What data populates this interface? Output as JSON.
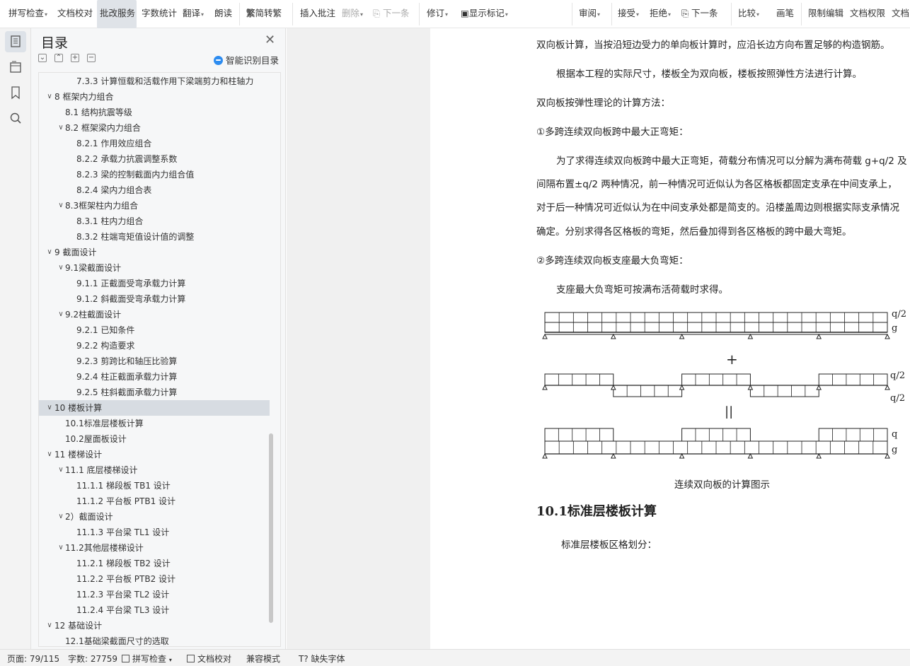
{
  "ribbon": {
    "spell_check": "拼写检查",
    "doc_proofread": "文档校对",
    "review_service": "批改服务",
    "word_count": "字数统计",
    "translate": "翻译",
    "read_aloud": "朗读",
    "simp_trad": "简转繁",
    "insert_comment": "插入批注",
    "delete": "删除",
    "next": "下一条",
    "track_changes": "修订",
    "show_markup": "显示标记",
    "review": "审阅",
    "accept": "接受",
    "reject": "拒绝",
    "next2": "下一条",
    "compare": "比较",
    "pen": "画笔",
    "restrict_edit": "限制编辑",
    "doc_permission": "文档权限",
    "more": "文档"
  },
  "toc": {
    "title": "目录",
    "smart_label": "智能识别目录",
    "items": [
      {
        "level": 3,
        "expand": "",
        "text": "7.3.3  计算恒载和活载作用下梁端剪力和柱轴力"
      },
      {
        "level": 1,
        "expand": "v",
        "text": "8  框架内力组合"
      },
      {
        "level": 2,
        "expand": "",
        "text": "8.1  结构抗震等级"
      },
      {
        "level": 2,
        "expand": "v",
        "text": "8.2  框架梁内力组合"
      },
      {
        "level": 3,
        "expand": "",
        "text": "8.2.1 作用效应组合"
      },
      {
        "level": 3,
        "expand": "",
        "text": "8.2.2 承载力抗震调整系数"
      },
      {
        "level": 3,
        "expand": "",
        "text": "8.2.3 梁的控制截面内力组合值"
      },
      {
        "level": 3,
        "expand": "",
        "text": "8.2.4 梁内力组合表"
      },
      {
        "level": 2,
        "expand": "v",
        "text": "8.3框架柱内力组合"
      },
      {
        "level": 3,
        "expand": "",
        "text": "8.3.1 柱内力组合"
      },
      {
        "level": 3,
        "expand": "",
        "text": "8.3.2  柱端弯矩值设计值的调整"
      },
      {
        "level": 1,
        "expand": "v",
        "text": "9  截面设计"
      },
      {
        "level": 2,
        "expand": "v",
        "text": "9.1梁截面设计"
      },
      {
        "level": 3,
        "expand": "",
        "text": "9.1.1 正截面受弯承载力计算"
      },
      {
        "level": 3,
        "expand": "",
        "text": "9.1.2 斜截面受弯承载力计算"
      },
      {
        "level": 2,
        "expand": "v",
        "text": "9.2柱截面设计"
      },
      {
        "level": 3,
        "expand": "",
        "text": "9.2.1 已知条件"
      },
      {
        "level": 3,
        "expand": "",
        "text": "9.2.2 构造要求"
      },
      {
        "level": 3,
        "expand": "",
        "text": "9.2.3 剪跨比和轴压比验算"
      },
      {
        "level": 3,
        "expand": "",
        "text": "9.2.4 柱正截面承载力计算"
      },
      {
        "level": 3,
        "expand": "",
        "text": "9.2.5 柱斜截面承载力计算"
      },
      {
        "level": 1,
        "expand": "v",
        "text": "10 楼板计算",
        "selected": true
      },
      {
        "level": 2,
        "expand": "",
        "text": "10.1标准层楼板计算"
      },
      {
        "level": 2,
        "expand": "",
        "text": "10.2屋面板设计"
      },
      {
        "level": 1,
        "expand": "v",
        "text": "11  楼梯设计"
      },
      {
        "level": 2,
        "expand": "v",
        "text": "11.1  底层楼梯设计"
      },
      {
        "level": 3,
        "expand": "",
        "text": "11.1.1 梯段板 TB1 设计"
      },
      {
        "level": 3,
        "expand": "",
        "text": "11.1.2 平台板 PTB1 设计"
      },
      {
        "level": 2,
        "expand": "v",
        "text": "2）截面设计"
      },
      {
        "level": 3,
        "expand": "",
        "text": "11.1.3 平台梁 TL1 设计"
      },
      {
        "level": 2,
        "expand": "v",
        "text": "11.2其他层楼梯设计"
      },
      {
        "level": 3,
        "expand": "",
        "text": "11.2.1 梯段板 TB2 设计"
      },
      {
        "level": 3,
        "expand": "",
        "text": "11.2.2 平台板 PTB2 设计"
      },
      {
        "level": 3,
        "expand": "",
        "text": "11.2.3 平台梁 TL2 设计"
      },
      {
        "level": 3,
        "expand": "",
        "text": "11.2.4 平台梁 TL3 设计"
      },
      {
        "level": 1,
        "expand": "v",
        "text": "12  基础设计"
      },
      {
        "level": 2,
        "expand": "",
        "text": "12.1基础梁截面尺寸的选取"
      }
    ]
  },
  "doc": {
    "line1": "双向板计算，当按沿短边受力的单向板计算时，应沿长边方向布置足够的构造钢筋。",
    "line2": "根据本工程的实际尺寸，楼板全为双向板，楼板按照弹性方法进行计算。",
    "line3": "双向板按弹性理论的计算方法：",
    "line4": "①多跨连续双向板跨中最大正弯矩：",
    "line5": "为了求得连续双向板跨中最大正弯矩，荷载分布情况可以分解为满布荷载 g+q/2 及",
    "line6": "间隔布置±q/2 两种情况，前一种情况可近似认为各区格板都固定支承在中间支承上，",
    "line7": "对于后一种情况可近似认为在中间支承处都是简支的。沿楼盖周边则根据实际支承情况",
    "line8": "确定。分别求得各区格板的弯矩，然后叠加得到各区格板的跨中最大弯矩。",
    "line9": "②多跨连续双向板支座最大负弯矩：",
    "line10": "支座最大负弯矩可按满布活荷载时求得。",
    "caption": "连续双向板的计算图示",
    "heading": "10.1标准层楼板计算",
    "line11": "标准层楼板区格划分：",
    "diagram": {
      "label_q2": "q/2",
      "label_g": "g",
      "label_pm1": "q/2",
      "label_pm2": "q/2",
      "label_q": "q",
      "label_g2": "g",
      "plus": "+",
      "equals": "||"
    }
  },
  "status": {
    "page": "页面: 79/115",
    "words": "字数: 27759",
    "spell": "拼写检查",
    "proof": "文档校对",
    "compat": "兼容模式",
    "missing_font": "缺失字体"
  }
}
